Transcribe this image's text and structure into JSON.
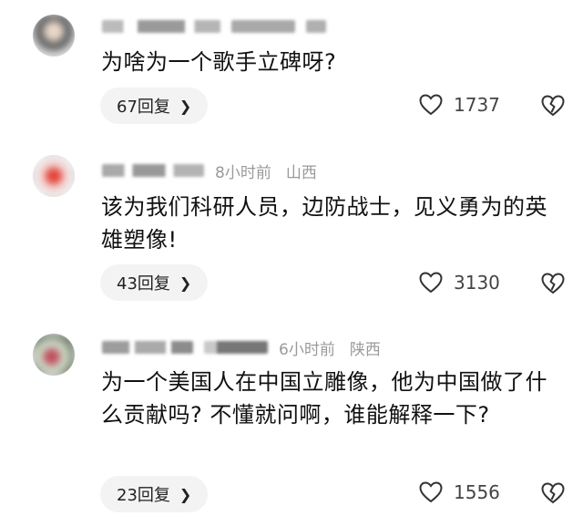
{
  "comments": [
    {
      "time": "",
      "location": "",
      "text": "为啥为一个歌手立碑呀?",
      "reply_label": "67回复",
      "likes": "1737"
    },
    {
      "time": "8小时前",
      "location": "山西",
      "text": "该为我们科研人员，边防战士，见义勇为的英雄塑像!",
      "reply_label": "43回复",
      "likes": "3130"
    },
    {
      "time": "6小时前",
      "location": "陕西",
      "text": "为一个美国人在中国立雕像，他为中国做了什么贡献吗? 不懂就问啊，谁能解释一下?",
      "reply_label": "23回复",
      "likes": "1556"
    }
  ],
  "icons": {
    "like": "heart-outline-icon",
    "dislike": "broken-heart-icon",
    "reply_arrow": "chevron-right-icon"
  }
}
